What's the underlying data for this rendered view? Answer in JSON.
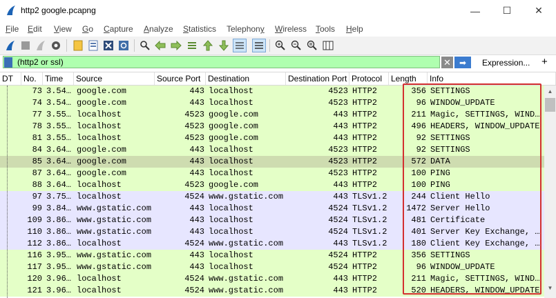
{
  "window": {
    "title": "http2 google.pcapng",
    "minimize": "—",
    "maximize": "☐",
    "close": "✕"
  },
  "menu": [
    {
      "first": "F",
      "rest": "ile"
    },
    {
      "first": "E",
      "rest": "dit"
    },
    {
      "first": "V",
      "rest": "iew"
    },
    {
      "first": "G",
      "rest": "o"
    },
    {
      "first": "C",
      "rest": "apture"
    },
    {
      "first": "A",
      "rest": "nalyze"
    },
    {
      "first": "S",
      "rest": "tatistics"
    },
    {
      "first": "",
      "rest": "Telephon",
      "last": "y"
    },
    {
      "first": "W",
      "rest": "ireless"
    },
    {
      "first": "T",
      "rest": "ools"
    },
    {
      "first": "H",
      "rest": "elp"
    }
  ],
  "filter": {
    "value": "(http2 or ssl)",
    "expression_label": "Expression...",
    "plus_label": "+",
    "clear_icon": "✕",
    "apply_icon": "➡"
  },
  "columns": [
    "DT",
    "No.",
    "Time",
    "Source",
    "Source Port",
    "Destination",
    "Destination Port",
    "Protocol",
    "Length",
    "Info"
  ],
  "colors": {
    "http2_row": "#e4ffc7",
    "tls_row": "#e7e6ff",
    "selected_row": "#cedcb0",
    "highlight": "#d32f2f"
  },
  "packets": [
    {
      "no": "73",
      "time": "3.54…",
      "source": "google.com",
      "sport": "443",
      "dest": "localhost",
      "dport": "4523",
      "proto": "HTTP2",
      "len": "356",
      "info": "SETTINGS",
      "type": "http2"
    },
    {
      "no": "74",
      "time": "3.54…",
      "source": "google.com",
      "sport": "443",
      "dest": "localhost",
      "dport": "4523",
      "proto": "HTTP2",
      "len": "96",
      "info": "WINDOW_UPDATE",
      "type": "http2"
    },
    {
      "no": "77",
      "time": "3.55…",
      "source": "localhost",
      "sport": "4523",
      "dest": "google.com",
      "dport": "443",
      "proto": "HTTP2",
      "len": "211",
      "info": "Magic, SETTINGS, WIND…",
      "type": "http2"
    },
    {
      "no": "78",
      "time": "3.55…",
      "source": "localhost",
      "sport": "4523",
      "dest": "google.com",
      "dport": "443",
      "proto": "HTTP2",
      "len": "496",
      "info": "HEADERS, WINDOW_UPDATE",
      "type": "http2"
    },
    {
      "no": "81",
      "time": "3.55…",
      "source": "localhost",
      "sport": "4523",
      "dest": "google.com",
      "dport": "443",
      "proto": "HTTP2",
      "len": "92",
      "info": "SETTINGS",
      "type": "http2"
    },
    {
      "no": "84",
      "time": "3.64…",
      "source": "google.com",
      "sport": "443",
      "dest": "localhost",
      "dport": "4523",
      "proto": "HTTP2",
      "len": "92",
      "info": "SETTINGS",
      "type": "http2"
    },
    {
      "no": "85",
      "time": "3.64…",
      "source": "google.com",
      "sport": "443",
      "dest": "localhost",
      "dport": "4523",
      "proto": "HTTP2",
      "len": "572",
      "info": "DATA",
      "type": "selected"
    },
    {
      "no": "87",
      "time": "3.64…",
      "source": "google.com",
      "sport": "443",
      "dest": "localhost",
      "dport": "4523",
      "proto": "HTTP2",
      "len": "100",
      "info": "PING",
      "type": "http2"
    },
    {
      "no": "88",
      "time": "3.64…",
      "source": "localhost",
      "sport": "4523",
      "dest": "google.com",
      "dport": "443",
      "proto": "HTTP2",
      "len": "100",
      "info": "PING",
      "type": "http2"
    },
    {
      "no": "97",
      "time": "3.75…",
      "source": "localhost",
      "sport": "4524",
      "dest": "www.gstatic.com",
      "dport": "443",
      "proto": "TLSv1.2",
      "len": "244",
      "info": "Client Hello",
      "type": "tls"
    },
    {
      "no": "99",
      "time": "3.84…",
      "source": "www.gstatic.com",
      "sport": "443",
      "dest": "localhost",
      "dport": "4524",
      "proto": "TLSv1.2",
      "len": "1472",
      "info": "Server Hello",
      "type": "tls"
    },
    {
      "no": "109",
      "time": "3.86…",
      "source": "www.gstatic.com",
      "sport": "443",
      "dest": "localhost",
      "dport": "4524",
      "proto": "TLSv1.2",
      "len": "481",
      "info": "Certificate",
      "type": "tls"
    },
    {
      "no": "110",
      "time": "3.86…",
      "source": "www.gstatic.com",
      "sport": "443",
      "dest": "localhost",
      "dport": "4524",
      "proto": "TLSv1.2",
      "len": "401",
      "info": "Server Key Exchange, …",
      "type": "tls"
    },
    {
      "no": "112",
      "time": "3.86…",
      "source": "localhost",
      "sport": "4524",
      "dest": "www.gstatic.com",
      "dport": "443",
      "proto": "TLSv1.2",
      "len": "180",
      "info": "Client Key Exchange, …",
      "type": "tls"
    },
    {
      "no": "116",
      "time": "3.95…",
      "source": "www.gstatic.com",
      "sport": "443",
      "dest": "localhost",
      "dport": "4524",
      "proto": "HTTP2",
      "len": "356",
      "info": "SETTINGS",
      "type": "http2"
    },
    {
      "no": "117",
      "time": "3.95…",
      "source": "www.gstatic.com",
      "sport": "443",
      "dest": "localhost",
      "dport": "4524",
      "proto": "HTTP2",
      "len": "96",
      "info": "WINDOW_UPDATE",
      "type": "http2"
    },
    {
      "no": "120",
      "time": "3.96…",
      "source": "localhost",
      "sport": "4524",
      "dest": "www.gstatic.com",
      "dport": "443",
      "proto": "HTTP2",
      "len": "211",
      "info": "Magic, SETTINGS, WIND…",
      "type": "http2"
    },
    {
      "no": "121",
      "time": "3.96…",
      "source": "localhost",
      "sport": "4524",
      "dest": "www.gstatic.com",
      "dport": "443",
      "proto": "HTTP2",
      "len": "520",
      "info": "HEADERS, WINDOW_UPDATE",
      "type": "http2"
    }
  ]
}
